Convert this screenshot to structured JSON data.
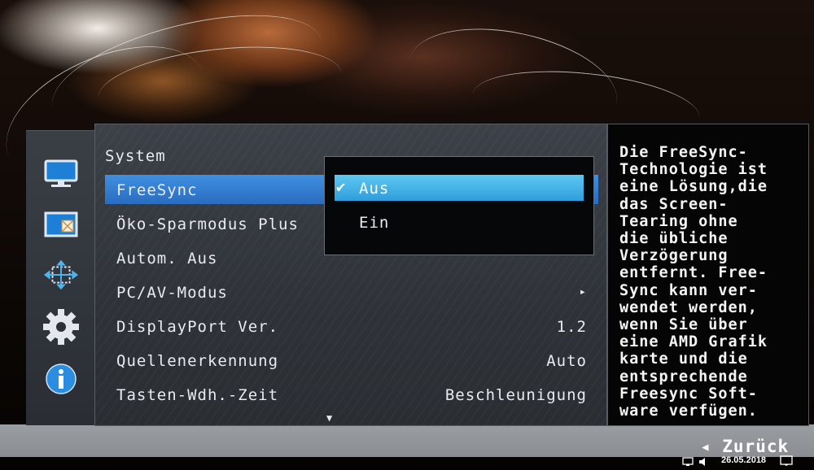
{
  "menu": {
    "title": "System",
    "items": [
      {
        "label": "FreeSync",
        "value": ""
      },
      {
        "label": "Öko-Sparmodus Plus",
        "value": ""
      },
      {
        "label": "Autom. Aus",
        "value": ""
      },
      {
        "label": "PC/AV-Modus",
        "value": "▸"
      },
      {
        "label": "DisplayPort Ver.",
        "value": "1.2"
      },
      {
        "label": "Quellenerkennung",
        "value": "Auto"
      },
      {
        "label": "Tasten-Wdh.-Zeit",
        "value": "Beschleunigung"
      }
    ],
    "scroll_indicator": "▼"
  },
  "freesync_popup": {
    "options": [
      {
        "label": "Aus",
        "check": "✔"
      },
      {
        "label": "Ein",
        "check": ""
      }
    ]
  },
  "help": {
    "text": "Die FreeSync-\nTechnologie ist\neine Lösung,die\ndas Screen-\nTearing ohne\ndie übliche\nVerzögerung\nentfernt. Free-\nSync kann ver-\nwendet werden,\nwenn Sie über\neine AMD Grafik\nkarte und die\nentsprechende\nFreesync Soft-\nware verfügen."
  },
  "nav": {
    "back_label": "◂ Zurück"
  },
  "tray": {
    "date": "26.05.2018"
  },
  "sidebar_icons": [
    "monitor-icon",
    "picture-icon",
    "position-icon",
    "gear-icon",
    "info-icon"
  ],
  "colors": {
    "selected_row": "#2f78cf",
    "popup_active": "#3aaee4",
    "panel_bg": "#33373d"
  }
}
